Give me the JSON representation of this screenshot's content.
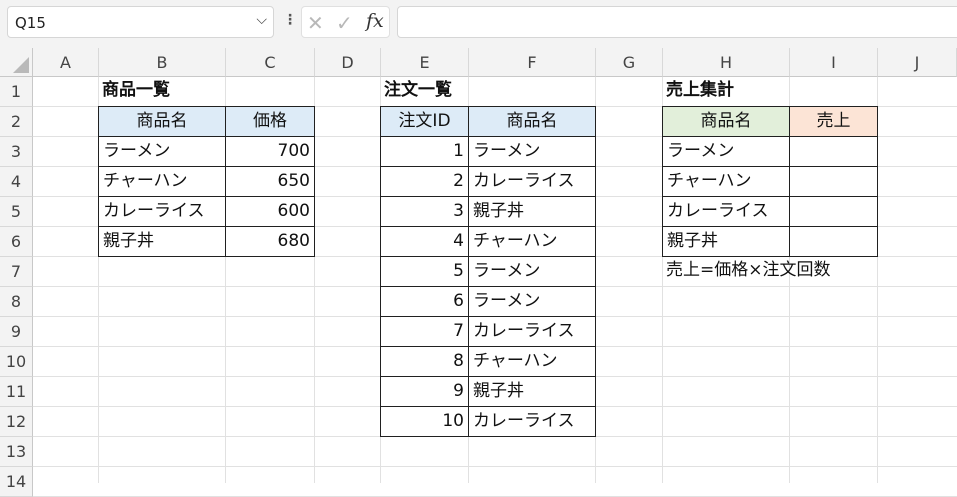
{
  "formula_bar": {
    "name_box": "Q15",
    "formula": "",
    "icons": [
      "chevron-down-icon",
      "more-vertical-icon",
      "cancel-x-icon",
      "confirm-check-icon",
      "fx-icon"
    ]
  },
  "columns": [
    "A",
    "B",
    "C",
    "D",
    "E",
    "F",
    "G",
    "H",
    "I",
    "J"
  ],
  "rows": [
    "1",
    "2",
    "3",
    "4",
    "5",
    "6",
    "7",
    "8",
    "9",
    "10",
    "11",
    "12",
    "13",
    "14"
  ],
  "products": {
    "title": "商品一覧",
    "headers": [
      "商品名",
      "価格"
    ],
    "rows": [
      [
        "ラーメン",
        "700"
      ],
      [
        "チャーハン",
        "650"
      ],
      [
        "カレーライス",
        "600"
      ],
      [
        "親子丼",
        "680"
      ]
    ]
  },
  "orders": {
    "title": "注文一覧",
    "headers": [
      "注文ID",
      "商品名"
    ],
    "rows": [
      [
        "1",
        "ラーメン"
      ],
      [
        "2",
        "カレーライス"
      ],
      [
        "3",
        "親子丼"
      ],
      [
        "4",
        "チャーハン"
      ],
      [
        "5",
        "ラーメン"
      ],
      [
        "6",
        "ラーメン"
      ],
      [
        "7",
        "カレーライス"
      ],
      [
        "8",
        "チャーハン"
      ],
      [
        "9",
        "親子丼"
      ],
      [
        "10",
        "カレーライス"
      ]
    ]
  },
  "summary": {
    "title": "売上集計",
    "headers": [
      "商品名",
      "売上"
    ],
    "rows": [
      [
        "ラーメン",
        ""
      ],
      [
        "チャーハン",
        ""
      ],
      [
        "カレーライス",
        ""
      ],
      [
        "親子丼",
        ""
      ]
    ],
    "note": "売上=価格×注文回数"
  },
  "colors": {
    "header_blue": "#ddebf7",
    "header_green": "#e2efda",
    "header_orange": "#fce4d6"
  }
}
